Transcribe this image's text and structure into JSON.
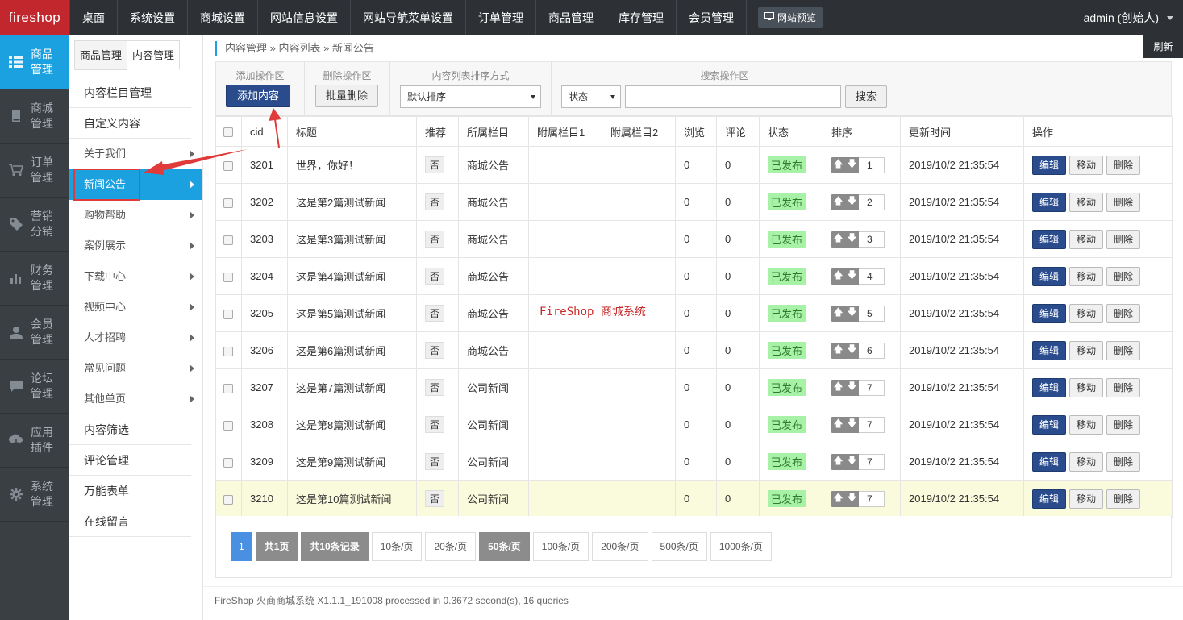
{
  "header": {
    "logo": "fireshop",
    "nav": [
      "桌面",
      "系统设置",
      "商城设置",
      "网站信息设置",
      "网站导航菜单设置",
      "订单管理",
      "商品管理",
      "库存管理",
      "会员管理"
    ],
    "preview_label": "网站预览",
    "user": "admin (创始人)"
  },
  "leftbar": [
    {
      "label": "商品管理",
      "icon": "list-icon",
      "active": true
    },
    {
      "label": "商城管理",
      "icon": "book-icon"
    },
    {
      "label": "订单管理",
      "icon": "cart-icon"
    },
    {
      "label": "营销分销",
      "icon": "tag-icon"
    },
    {
      "label": "财务管理",
      "icon": "bar-chart-icon"
    },
    {
      "label": "会员管理",
      "icon": "user-icon"
    },
    {
      "label": "论坛管理",
      "icon": "comment-icon"
    },
    {
      "label": "应用插件",
      "icon": "cloud-download-icon"
    },
    {
      "label": "系统管理",
      "icon": "gear-icon"
    }
  ],
  "subbar": {
    "tabs": [
      "商品管理",
      "内容管理"
    ],
    "items": {
      "i0": "内容栏目管理",
      "i1": "自定义内容",
      "i2": "关于我们",
      "i3": "新闻公告",
      "i4": "购物帮助",
      "i5": "案例展示",
      "i6": "下载中心",
      "i7": "视频中心",
      "i8": "人才招聘",
      "i9": "常见问题",
      "i10": "其他单页",
      "i11": "内容筛选",
      "i12": "评论管理",
      "i13": "万能表单",
      "i14": "在线留言"
    }
  },
  "breadcrumb": "内容管理 » 内容列表 » 新闻公告",
  "refresh_label": "刷新",
  "toolbar": {
    "add_title": "添加操作区",
    "add_label": "添加内容",
    "delete_title": "删除操作区",
    "delete_label": "批量删除",
    "sort_title": "内容列表排序方式",
    "sort_value": "默认排序",
    "search_title": "搜索操作区",
    "status_value": "状态",
    "search_value": "",
    "search_label": "搜索"
  },
  "table": {
    "headers": {
      "cid": "cid",
      "title": "标题",
      "rec": "推荐",
      "col": "所属栏目",
      "col1": "附属栏目1",
      "col2": "附属栏目2",
      "views": "浏览",
      "comments": "评论",
      "status": "状态",
      "sort": "排序",
      "updated": "更新时间",
      "ops": "操作"
    },
    "edit_label": "编辑",
    "move_label": "移动",
    "delete_label": "删除",
    "rows": [
      {
        "cid": "3201",
        "title": "世界，你好！",
        "rec": "否",
        "col": "商城公告",
        "col1": "",
        "col2": "",
        "views": "0",
        "comments": "0",
        "status": "已发布",
        "sort": "1",
        "updated": "2019/10/2 21:35:54",
        "edit": "编辑",
        "move": "移动",
        "del": "删除"
      },
      {
        "cid": "3202",
        "title": "这是第2篇测试新闻",
        "rec": "否",
        "col": "商城公告",
        "col1": "",
        "col2": "",
        "views": "0",
        "comments": "0",
        "status": "已发布",
        "sort": "2",
        "updated": "2019/10/2 21:35:54",
        "edit": "编辑",
        "move": "移动",
        "del": "删除"
      },
      {
        "cid": "3203",
        "title": "这是第3篇测试新闻",
        "rec": "否",
        "col": "商城公告",
        "col1": "",
        "col2": "",
        "views": "0",
        "comments": "0",
        "status": "已发布",
        "sort": "3",
        "updated": "2019/10/2 21:35:54",
        "edit": "编辑",
        "move": "移动",
        "del": "删除"
      },
      {
        "cid": "3204",
        "title": "这是第4篇测试新闻",
        "rec": "否",
        "col": "商城公告",
        "col1": "",
        "col2": "",
        "views": "0",
        "comments": "0",
        "status": "已发布",
        "sort": "4",
        "updated": "2019/10/2 21:35:54",
        "edit": "编辑",
        "move": "移动",
        "del": "删除"
      },
      {
        "cid": "3205",
        "title": "这是第5篇测试新闻",
        "rec": "否",
        "col": "商城公告",
        "col1": "",
        "col2": "",
        "views": "0",
        "comments": "0",
        "status": "已发布",
        "sort": "5",
        "updated": "2019/10/2 21:35:54",
        "edit": "编辑",
        "move": "移动",
        "del": "删除"
      },
      {
        "cid": "3206",
        "title": "这是第6篇测试新闻",
        "rec": "否",
        "col": "商城公告",
        "col1": "",
        "col2": "",
        "views": "0",
        "comments": "0",
        "status": "已发布",
        "sort": "6",
        "updated": "2019/10/2 21:35:54",
        "edit": "编辑",
        "move": "移动",
        "del": "删除"
      },
      {
        "cid": "3207",
        "title": "这是第7篇测试新闻",
        "rec": "否",
        "col": "公司新闻",
        "col1": "",
        "col2": "",
        "views": "0",
        "comments": "0",
        "status": "已发布",
        "sort": "7",
        "updated": "2019/10/2 21:35:54",
        "edit": "编辑",
        "move": "移动",
        "del": "删除"
      },
      {
        "cid": "3208",
        "title": "这是第8篇测试新闻",
        "rec": "否",
        "col": "公司新闻",
        "col1": "",
        "col2": "",
        "views": "0",
        "comments": "0",
        "status": "已发布",
        "sort": "7",
        "updated": "2019/10/2 21:35:54",
        "edit": "编辑",
        "move": "移动",
        "del": "删除"
      },
      {
        "cid": "3209",
        "title": "这是第9篇测试新闻",
        "rec": "否",
        "col": "公司新闻",
        "col1": "",
        "col2": "",
        "views": "0",
        "comments": "0",
        "status": "已发布",
        "sort": "7",
        "updated": "2019/10/2 21:35:54",
        "edit": "编辑",
        "move": "移动",
        "del": "删除"
      },
      {
        "cid": "3210",
        "title": "这是第10篇测试新闻",
        "rec": "否",
        "col": "公司新闻",
        "col1": "",
        "col2": "",
        "views": "0",
        "comments": "0",
        "status": "已发布",
        "sort": "7",
        "updated": "2019/10/2 21:35:54",
        "edit": "编辑",
        "move": "移动",
        "del": "删除"
      }
    ]
  },
  "pagination": {
    "current": "1",
    "total_pages": "共1页",
    "total_records": "共10条记录",
    "sizes": [
      "10条/页",
      "20条/页",
      "50条/页",
      "100条/页",
      "200条/页",
      "500条/页",
      "1000条/页"
    ],
    "selected_size": "50条/页"
  },
  "watermark": "FireShop 商城系统",
  "footer": "FireShop 火商商城系统 X1.1.1_191008 processed in 0.3672 second(s), 16 queries",
  "colors": {
    "logo_bg": "#c1272d",
    "topbar_bg": "#2d3136",
    "accent": "#1ba0e0",
    "primary_btn": "#2a4c8c",
    "status_green": "#a8f2a8",
    "annotation_red": "#e03a3a"
  }
}
